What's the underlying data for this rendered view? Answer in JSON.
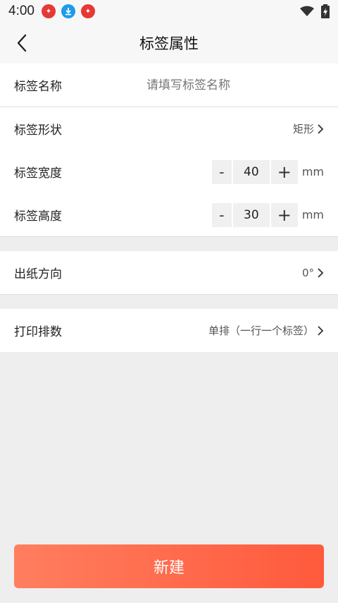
{
  "status": {
    "time": "4:00",
    "app_icons": [
      "app-badge-icon",
      "download-icon",
      "app-badge-icon"
    ]
  },
  "nav": {
    "title": "标签属性"
  },
  "fields": {
    "name": {
      "label": "标签名称",
      "placeholder": "请填写标签名称",
      "value": ""
    },
    "shape": {
      "label": "标签形状",
      "value": "矩形"
    },
    "width": {
      "label": "标签宽度",
      "minus": "-",
      "value": "40",
      "plus": "+",
      "unit": "mm"
    },
    "height": {
      "label": "标签高度",
      "minus": "-",
      "value": "30",
      "plus": "+",
      "unit": "mm"
    },
    "direction": {
      "label": "出纸方向",
      "value": "0°"
    },
    "rows": {
      "label": "打印排数",
      "value": "单排（一行一个标签）"
    }
  },
  "create_button": {
    "label": "新建"
  },
  "colors": {
    "accent_start": "#ff7e5f",
    "accent_end": "#ff5a3c"
  }
}
